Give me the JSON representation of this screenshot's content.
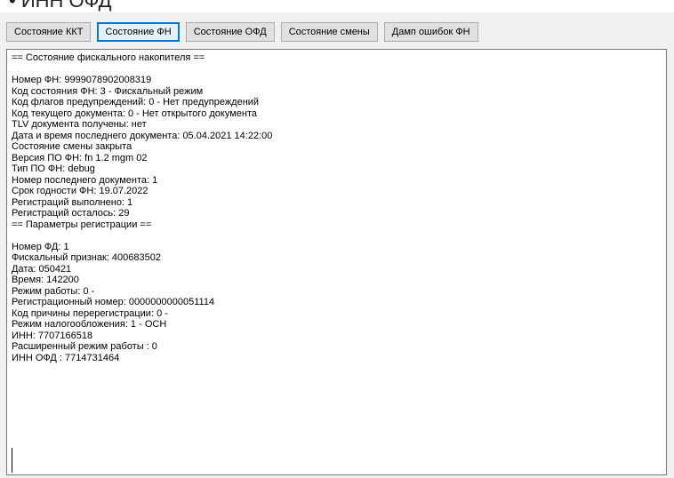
{
  "heading": "• ИНН ОФД",
  "toolbar": {
    "buttons": [
      {
        "label": "Состояние ККТ",
        "active": false
      },
      {
        "label": "Состояние ФН",
        "active": true
      },
      {
        "label": "Состояние ОФД",
        "active": false
      },
      {
        "label": "Состояние смены",
        "active": false
      },
      {
        "label": "Дамп ошибок ФН",
        "active": false
      }
    ]
  },
  "output": {
    "lines": [
      "== Состояние фискального накопителя ==",
      "",
      "Номер ФН: 9999078902008319",
      "Код состояния ФН: 3 - Фискальный режим",
      "Код флагов предупреждений: 0 - Нет предупреждений",
      "Код текущего документа: 0 - Нет открытого документа",
      "TLV документа получены: нет",
      "Дата и время последнего документа: 05.04.2021 14:22:00",
      "Состояние смены закрыта",
      "Версия ПО ФН: fn 1.2 mgm 02",
      "Тип ПО ФН: debug",
      "Номер последнего документа: 1",
      "Срок годности ФН: 19.07.2022",
      "Регистраций выполнено: 1",
      "Регистраций осталось: 29",
      "== Параметры регистрации ==",
      "",
      "Номер ФД: 1",
      "Фискальный признак: 400683502",
      "Дата: 050421",
      "Время: 142200",
      "Режим работы: 0 -",
      "Регистрационный номер: 0000000000051114",
      "Код причины перерегистрации: 0 -",
      "Режим налогообложения: 1 - ОСН",
      "ИНН: 7707166518",
      "Расширенный режим работы : 0",
      "ИНН ОФД : 7714731464"
    ]
  }
}
